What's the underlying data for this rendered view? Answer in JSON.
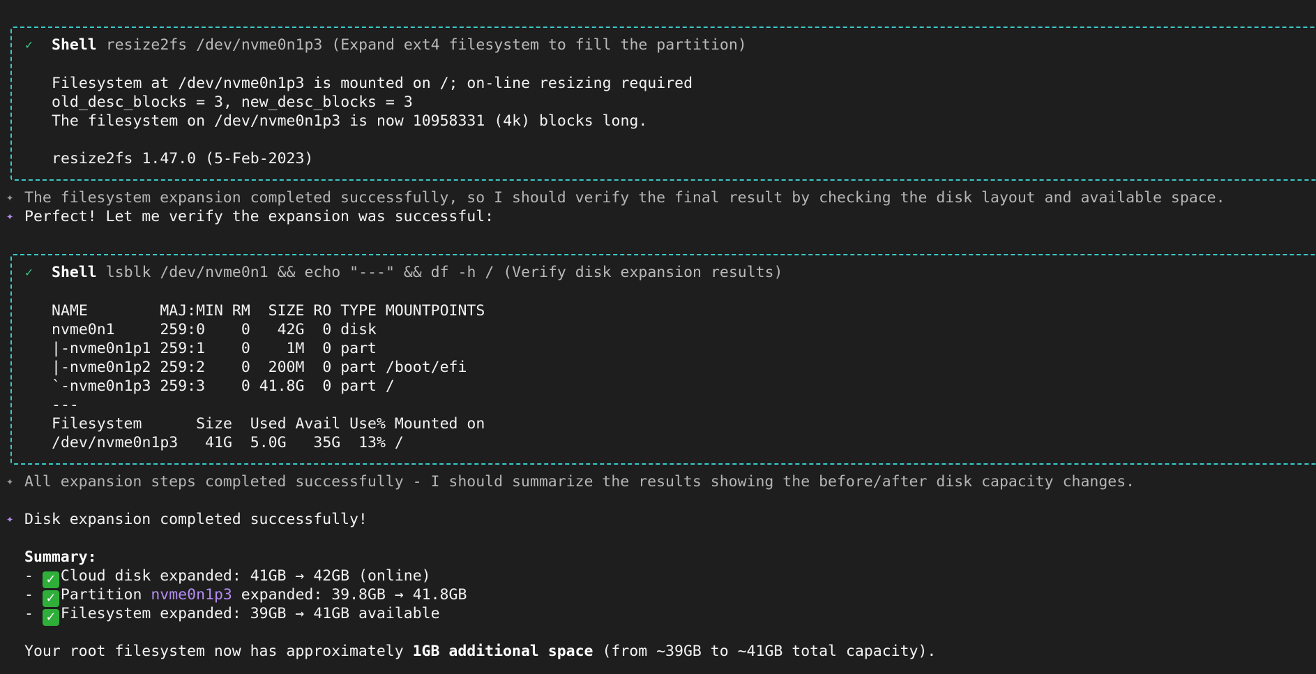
{
  "block1": {
    "check": "✓",
    "shell_label": "Shell",
    "command": "resize2fs /dev/nvme0n1p3 (Expand ext4 filesystem to fill the partition)",
    "output": [
      "Filesystem at /dev/nvme0n1p3 is mounted on /; on-line resizing required",
      "old_desc_blocks = 3, new_desc_blocks = 3",
      "The filesystem on /dev/nvme0n1p3 is now 10958331 (4k) blocks long.",
      "",
      "resize2fs 1.47.0 (5-Feb-2023)"
    ]
  },
  "thought1": "The filesystem expansion completed successfully, so I should verify the final result by checking the disk layout and available space.",
  "message1": "Perfect! Let me verify the expansion was successful:",
  "block2": {
    "check": "✓",
    "shell_label": "Shell",
    "command": "lsblk /dev/nvme0n1 && echo \"---\" && df -h / (Verify disk expansion results)",
    "output": [
      "NAME        MAJ:MIN RM  SIZE RO TYPE MOUNTPOINTS",
      "nvme0n1     259:0    0   42G  0 disk",
      "|-nvme0n1p1 259:1    0    1M  0 part",
      "|-nvme0n1p2 259:2    0  200M  0 part /boot/efi",
      "`-nvme0n1p3 259:3    0 41.8G  0 part /",
      "---",
      "Filesystem      Size  Used Avail Use% Mounted on",
      "/dev/nvme0n1p3   41G  5.0G   35G  13% /"
    ]
  },
  "thought2": "All expansion steps completed successfully - I should summarize the results showing the before/after disk capacity changes.",
  "message2": "Disk expansion completed successfully!",
  "summary": {
    "heading": "Summary:",
    "items": [
      {
        "prefix": "- ",
        "check": "✓",
        "text": "Cloud disk expanded: 41GB → 42GB (online)"
      },
      {
        "prefix": "- ",
        "check": "✓",
        "pre": "Partition ",
        "highlight": "nvme0n1p3",
        "post": " expanded: 39.8GB → 41.8GB"
      },
      {
        "prefix": "- ",
        "check": "✓",
        "text": "Filesystem expanded: 39GB → 41GB available"
      }
    ]
  },
  "final": {
    "pre": "Your root filesystem now has approximately ",
    "bold": "1GB additional space",
    "post": " (from ~39GB to ~41GB total capacity)."
  },
  "star_symbol": "✦",
  "colors": {
    "box_border": "#3cc9c9",
    "check_green": "#3cc98a",
    "accent_purple": "#b48cf2",
    "background": "#1e1e1e"
  }
}
